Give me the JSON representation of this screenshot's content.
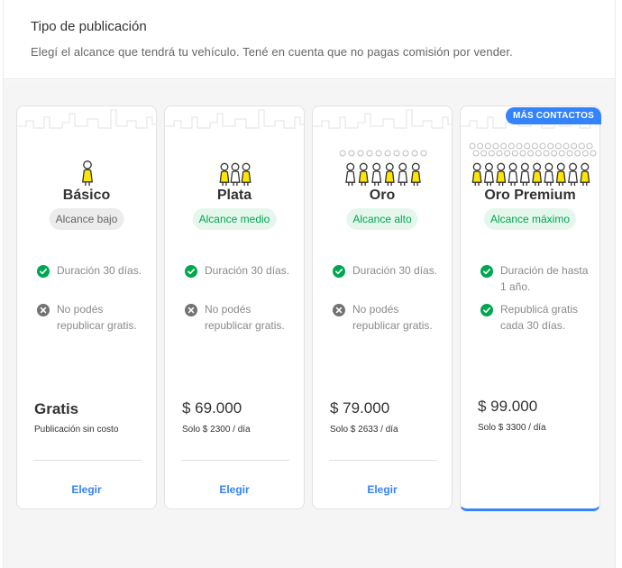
{
  "header": {
    "title": "Tipo de publicación",
    "subtitle": "Elegí el alcance que tendrá tu vehículo. Tené en cuenta que no pagas comisión por vender."
  },
  "plans": [
    {
      "name": "Básico",
      "reach": "Alcance bajo",
      "features": [
        {
          "icon": "check-circle-icon",
          "text": "Duración 30 días."
        },
        {
          "icon": "x-circle-icon",
          "text": "No podés republicar gratis."
        }
      ],
      "price": "Gratis",
      "price_note": "Publicación sin costo",
      "choose_label": "Elegir"
    },
    {
      "name": "Plata",
      "reach": "Alcance medio",
      "features": [
        {
          "icon": "check-circle-icon",
          "text": "Duración 30 días."
        },
        {
          "icon": "x-circle-icon",
          "text": "No podés republicar gratis."
        }
      ],
      "price": "$ 69.000",
      "price_note": "Solo $ 2300 / día",
      "choose_label": "Elegir"
    },
    {
      "name": "Oro",
      "reach": "Alcance alto",
      "features": [
        {
          "icon": "check-circle-icon",
          "text": "Duración 30 días."
        },
        {
          "icon": "x-circle-icon",
          "text": "No podés republicar gratis."
        }
      ],
      "price": "$ 79.000",
      "price_note": "Solo $ 2633 / día",
      "choose_label": "Elegir"
    },
    {
      "name": "Oro Premium",
      "reach": "Alcance máximo",
      "promo_badge": "MÁS CONTACTOS",
      "features": [
        {
          "icon": "check-circle-icon",
          "text": "Duración de hasta 1 año."
        },
        {
          "icon": "check-circle-icon",
          "text": "Republicá gratis cada 30 días."
        }
      ],
      "price": "$ 99.000",
      "price_note": "Solo $ 3300 / día"
    }
  ],
  "colors": {
    "accent": "#3483fa",
    "success": "#00a650",
    "success_bg": "#e5f7ed",
    "neutral_badge_bg": "#ececec",
    "figure_yellow": "#ffe600"
  }
}
